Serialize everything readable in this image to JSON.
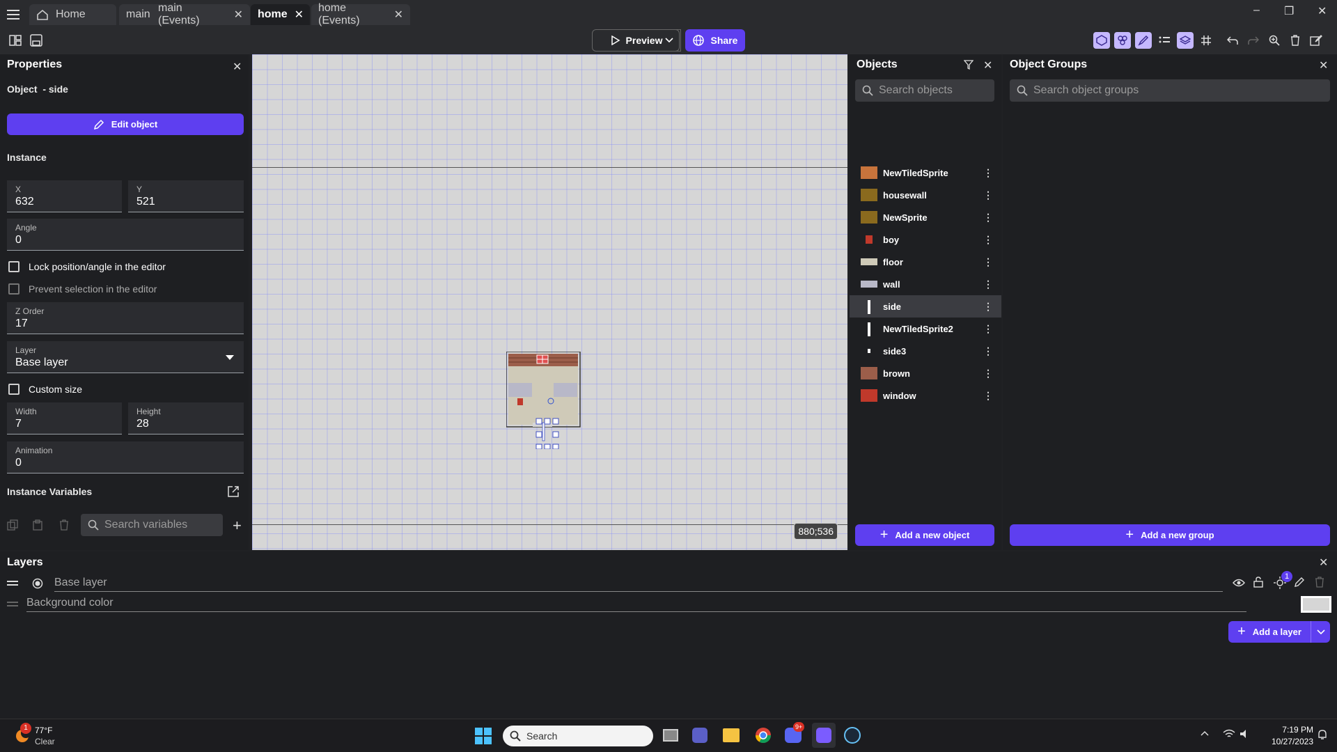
{
  "tabs": [
    {
      "label": "Home",
      "closable": false
    },
    {
      "label": "main",
      "closable": true
    },
    {
      "label": "main (Events)",
      "closable": true
    },
    {
      "label": "home",
      "closable": true,
      "active": true
    },
    {
      "label": "home (Events)",
      "closable": true
    }
  ],
  "toolbar": {
    "preview_label": "Preview",
    "share_label": "Share"
  },
  "properties": {
    "title": "Properties",
    "object_label": "Object  - side",
    "edit_button": "Edit object",
    "instance_heading": "Instance",
    "x_label": "X",
    "x_value": "632",
    "y_label": "Y",
    "y_value": "521",
    "angle_label": "Angle",
    "angle_value": "0",
    "lock_label": "Lock position/angle in the editor",
    "prevent_label": "Prevent selection in the editor",
    "zorder_label": "Z Order",
    "zorder_value": "17",
    "layer_label": "Layer",
    "layer_value": "Base layer",
    "custom_size_label": "Custom size",
    "width_label": "Width",
    "width_value": "7",
    "height_label": "Height",
    "height_value": "28",
    "animation_label": "Animation",
    "animation_value": "0",
    "instance_vars_heading": "Instance Variables",
    "search_vars_placeholder": "Search variables"
  },
  "canvas": {
    "coords": "880;536"
  },
  "objects": {
    "title": "Objects",
    "search_placeholder": "Search objects",
    "items": [
      {
        "name": "NewTiledSprite",
        "color": "#c8743c"
      },
      {
        "name": "housewall",
        "color": "#8a6a1e"
      },
      {
        "name": "NewSprite",
        "color": "#8a6a1e"
      },
      {
        "name": "boy",
        "color": "#c0392b"
      },
      {
        "name": "floor",
        "color": "#cfcab8"
      },
      {
        "name": "wall",
        "color": "#b8b8c8"
      },
      {
        "name": "side",
        "color": "#ffffff"
      },
      {
        "name": "NewTiledSprite2",
        "color": "#ffffff"
      },
      {
        "name": "side3",
        "color": "#ffffff"
      },
      {
        "name": "brown",
        "color": "#9c5e4a"
      },
      {
        "name": "window",
        "color": "#c0392b"
      }
    ],
    "add_button": "Add a new object"
  },
  "groups": {
    "title": "Object Groups",
    "search_placeholder": "Search object groups",
    "add_button": "Add a new group"
  },
  "layers": {
    "title": "Layers",
    "base_layer": "Base layer",
    "background_color": "Background color",
    "add_button": "Add a layer",
    "lights_badge": "1"
  },
  "taskbar": {
    "weather_temp": "77°F",
    "weather_desc": "Clear",
    "weather_badge": "1",
    "search_label": "Search",
    "discord_badge": "9+",
    "time": "7:19 PM",
    "date": "10/27/2023"
  },
  "colors": {
    "accent": "#5e3ff0",
    "panel_bg": "#1e1f22",
    "canvas_bg": "#d6d6d6"
  }
}
